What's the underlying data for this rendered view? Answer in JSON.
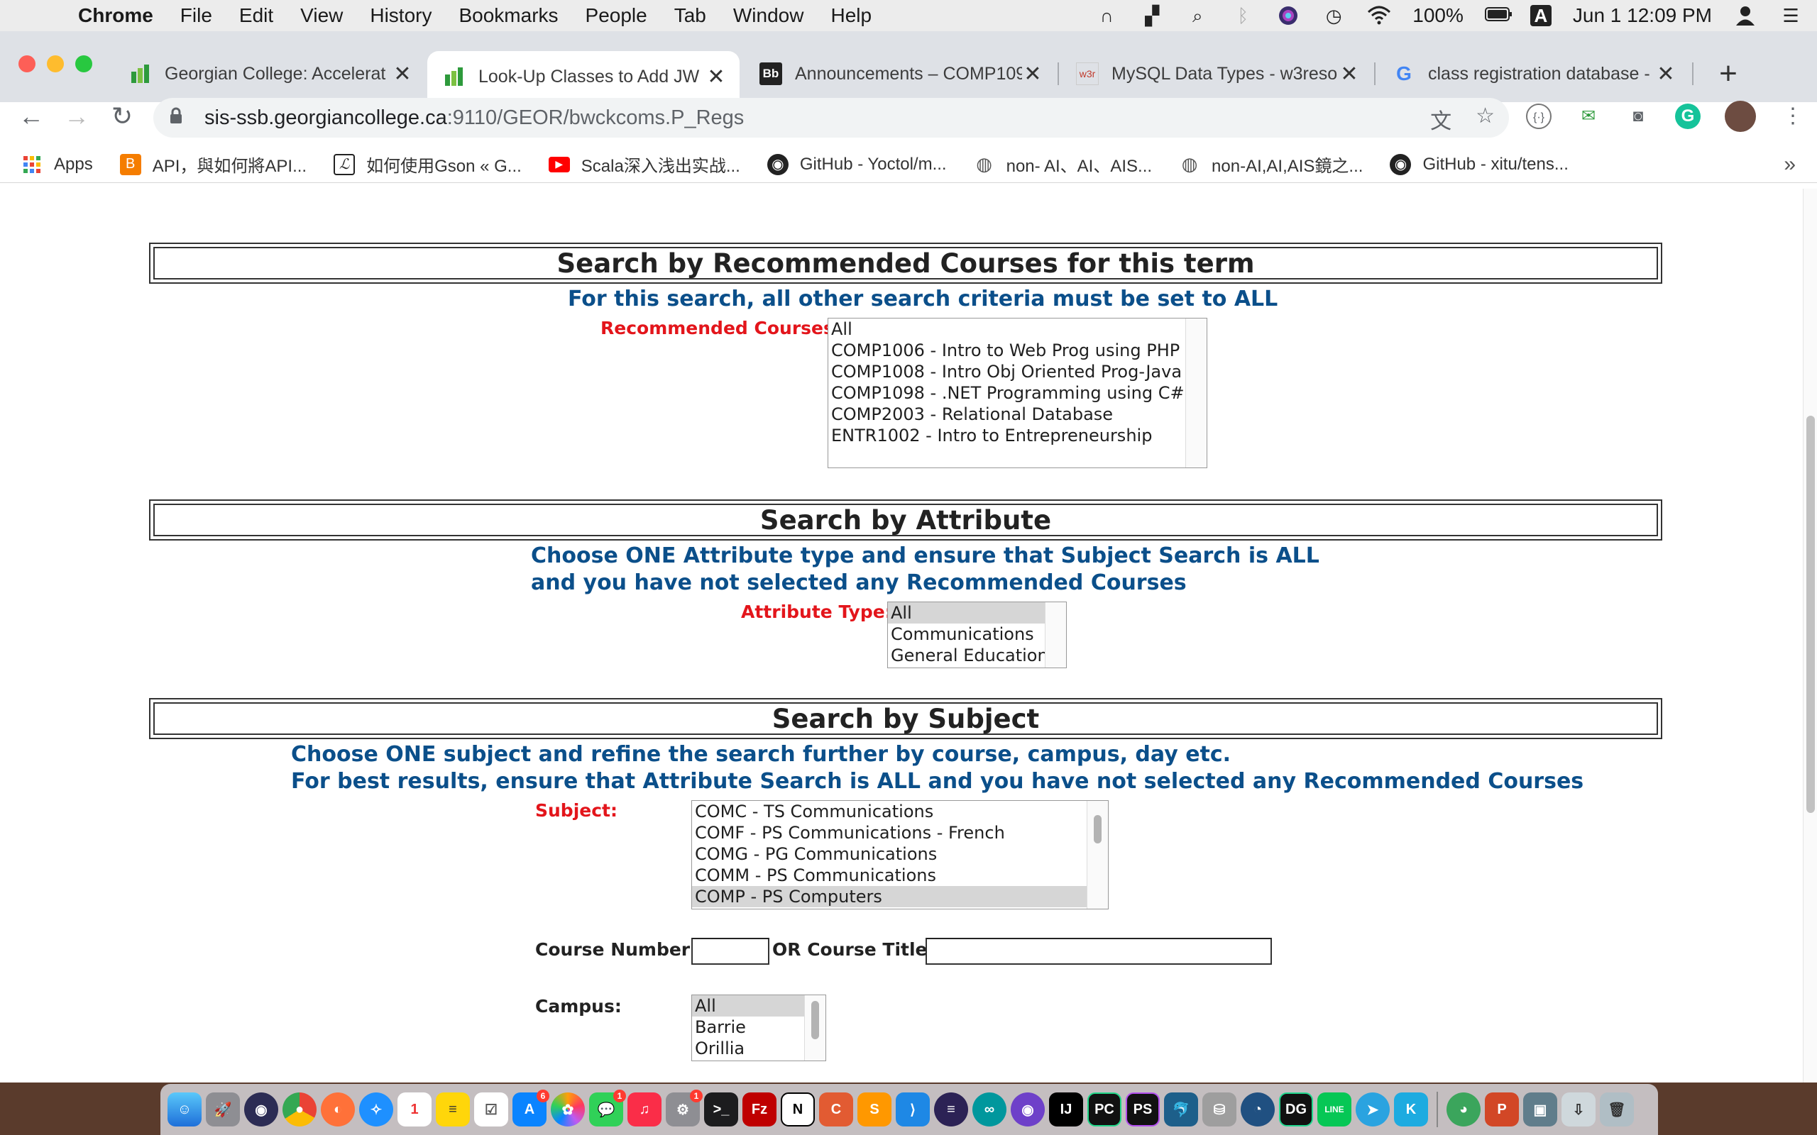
{
  "menubar": {
    "app": "Chrome",
    "items": [
      "File",
      "Edit",
      "View",
      "History",
      "Bookmarks",
      "People",
      "Tab",
      "Window",
      "Help"
    ],
    "battery": "100%",
    "input_source": "A",
    "clock": "Jun 1  12:09 PM"
  },
  "tabs": [
    {
      "title": "Georgian College: Accelerat",
      "favicon": "georgian-icon",
      "active": false
    },
    {
      "title": "Look-Up Classes to Add JW",
      "favicon": "georgian-icon",
      "active": true
    },
    {
      "title": "Announcements – COMP109",
      "favicon": "blackboard-icon",
      "active": false
    },
    {
      "title": "MySQL Data Types - w3reso",
      "favicon": "w3r-icon",
      "active": false
    },
    {
      "title": "class registration database -",
      "favicon": "google-icon",
      "active": false
    }
  ],
  "favicon_text": {
    "blackboard": "Bb",
    "w3r": "w3r",
    "google": "G"
  },
  "url": {
    "host": "sis-ssb.georgiancollege.ca",
    "path": ":9110/GEOR/bwckcoms.P_Regs"
  },
  "bookmarks": [
    {
      "label": "Apps",
      "icon": "apps-grid-icon"
    },
    {
      "label": "API，與如何將API...",
      "icon": "blogger-icon"
    },
    {
      "label": "如何使用Gson « G...",
      "icon": "l-logo-icon"
    },
    {
      "label": "Scala深入浅出实战...",
      "icon": "youtube-icon"
    },
    {
      "label": "GitHub - Yoctol/m...",
      "icon": "github-icon"
    },
    {
      "label": "non- AI、AI、AIS...",
      "icon": "globe-icon"
    },
    {
      "label": "non-AI,AI,AIS鏡之...",
      "icon": "globe-icon"
    },
    {
      "label": "GitHub - xitu/tens...",
      "icon": "github-icon"
    }
  ],
  "sections": {
    "recommended": {
      "title": "Search by Recommended Courses for this term",
      "note": "For this search, all other search criteria must be set to ALL",
      "label": "Recommended Courses:",
      "options": [
        "All",
        "COMP1006 - Intro to Web Prog using PHP",
        "COMP1008 - Intro Obj Oriented Prog-Java",
        "COMP1098 - .NET Programming using C#",
        "COMP2003 - Relational Database",
        "ENTR1002 - Intro to Entrepreneurship"
      ]
    },
    "attribute": {
      "title": "Search by Attribute",
      "note_line1": "Choose ONE Attribute type and ensure that Subject Search is ALL",
      "note_line2": "and you have not selected any Recommended Courses",
      "label": "Attribute Type:",
      "options": [
        "All",
        "Communications",
        "General Education"
      ],
      "selected": "All"
    },
    "subject": {
      "title": "Search by Subject",
      "note_line1": "Choose ONE subject and refine the search further by course, campus, day etc.",
      "note_line2": "For best results, ensure that Attribute Search is ALL and you have not selected any Recommended Courses",
      "label": "Subject:",
      "options": [
        "COMC - TS Communications",
        "COMF - PS Communications - French",
        "COMG - PG Communications",
        "COMM - PS Communications",
        "COMP - PS Computers"
      ],
      "selected": "COMP - PS Computers",
      "course_number_label": "Course Number:",
      "course_number_value": "",
      "course_title_label": "OR Course Title:",
      "course_title_value": "",
      "campus_label": "Campus:",
      "campus_options": [
        "All",
        "Barrie",
        "Orillia"
      ],
      "campus_selected": "All"
    }
  },
  "colors": {
    "note_blue": "#0b4f8a",
    "label_red": "#e3151b",
    "chrome_tabstrip": "#dee1e6"
  },
  "dock_icons": [
    "finder-icon",
    "launchpad-icon",
    "siri-icon",
    "chrome-icon",
    "firefox-icon",
    "safari-icon",
    "calendar-icon",
    "notes-icon",
    "reminders-icon",
    "app-store-icon",
    "photos-icon",
    "messages-icon",
    "music-icon",
    "system-preferences-icon",
    "terminal-icon",
    "filezilla-icon",
    "notion-icon",
    "c-app-icon",
    "sublime-icon",
    "vscode-icon",
    "eclipse-icon",
    "arduino-icon",
    "github-desktop-icon",
    "intellij-icon",
    "pycharm-icon",
    "phpstorm-icon",
    "mysql-workbench-icon",
    "database-icon",
    "sourcetree-icon",
    "datagrip-icon",
    "line-icon",
    "telegram-icon",
    "kite-icon",
    "preview-icon",
    "powerpoint-icon",
    "screenshot-icon",
    "downloads-icon",
    "trash-icon"
  ],
  "dock_badges": {
    "app_store": "6",
    "messages": "1",
    "system_preferences": "1"
  },
  "dock_labels": {
    "calendar_day": "1",
    "filezilla": "Fz",
    "notion": "N",
    "c_app": "C",
    "intellij": "IJ",
    "pycharm": "PC",
    "phpstorm": "PS",
    "datagrip": "DG",
    "line": "LINE",
    "kite": "K",
    "powerpoint": "P"
  }
}
